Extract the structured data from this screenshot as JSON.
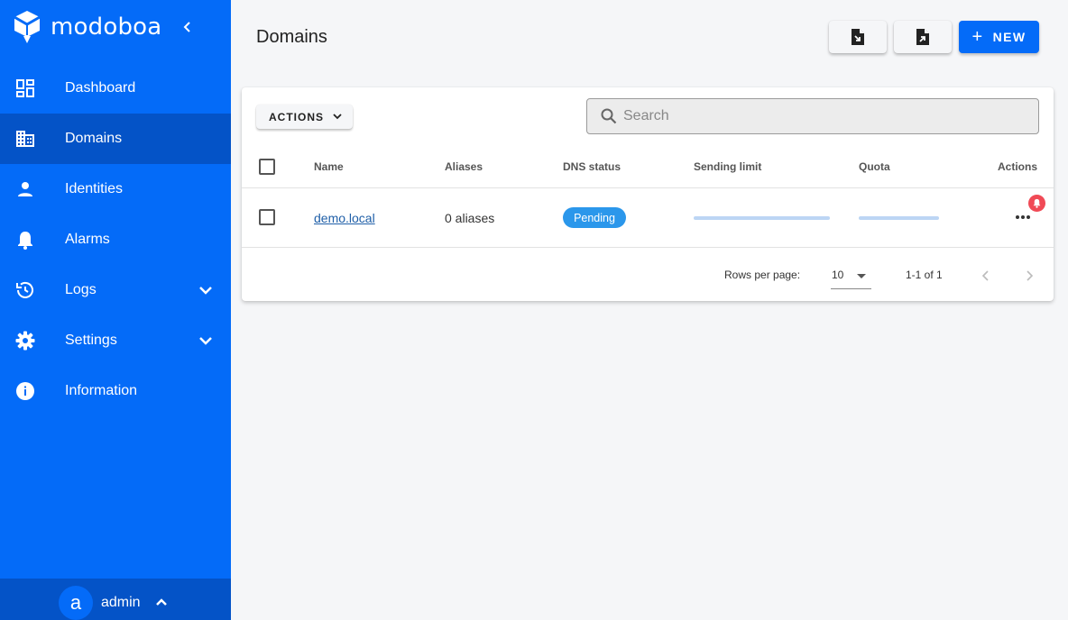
{
  "app": {
    "name": "modoboa"
  },
  "sidebar": {
    "items": [
      {
        "label": "Dashboard",
        "icon": "dashboard-icon"
      },
      {
        "label": "Domains",
        "icon": "domain-icon",
        "active": true
      },
      {
        "label": "Identities",
        "icon": "person-icon"
      },
      {
        "label": "Alarms",
        "icon": "bell-icon"
      },
      {
        "label": "Logs",
        "icon": "history-icon",
        "expandable": true
      },
      {
        "label": "Settings",
        "icon": "gear-icon",
        "expandable": true
      },
      {
        "label": "Information",
        "icon": "info-icon"
      }
    ],
    "user": {
      "initial": "a",
      "name": "admin"
    }
  },
  "header": {
    "title": "Domains",
    "import_icon": "file-import-icon",
    "export_icon": "file-export-icon",
    "new_label": "NEW",
    "new_icon": "plus-icon"
  },
  "toolbar": {
    "actions_label": "ACTIONS",
    "search_placeholder": "Search"
  },
  "table": {
    "headers": [
      "Name",
      "Aliases",
      "DNS status",
      "Sending limit",
      "Quota",
      "Actions"
    ],
    "rows": [
      {
        "name": "demo.local",
        "aliases": "0 aliases",
        "dns_status": "Pending",
        "sending_limit_used": 0,
        "quota_used": 0
      }
    ]
  },
  "footer": {
    "rows_per_page_label": "Rows per page:",
    "rows_per_page": "10",
    "range": "1-1 of 1"
  },
  "colors": {
    "sidebar": "#046bf8",
    "sidebar_active": "#0453c7",
    "badge": "#2b97eb",
    "alert": "#f04a56"
  }
}
